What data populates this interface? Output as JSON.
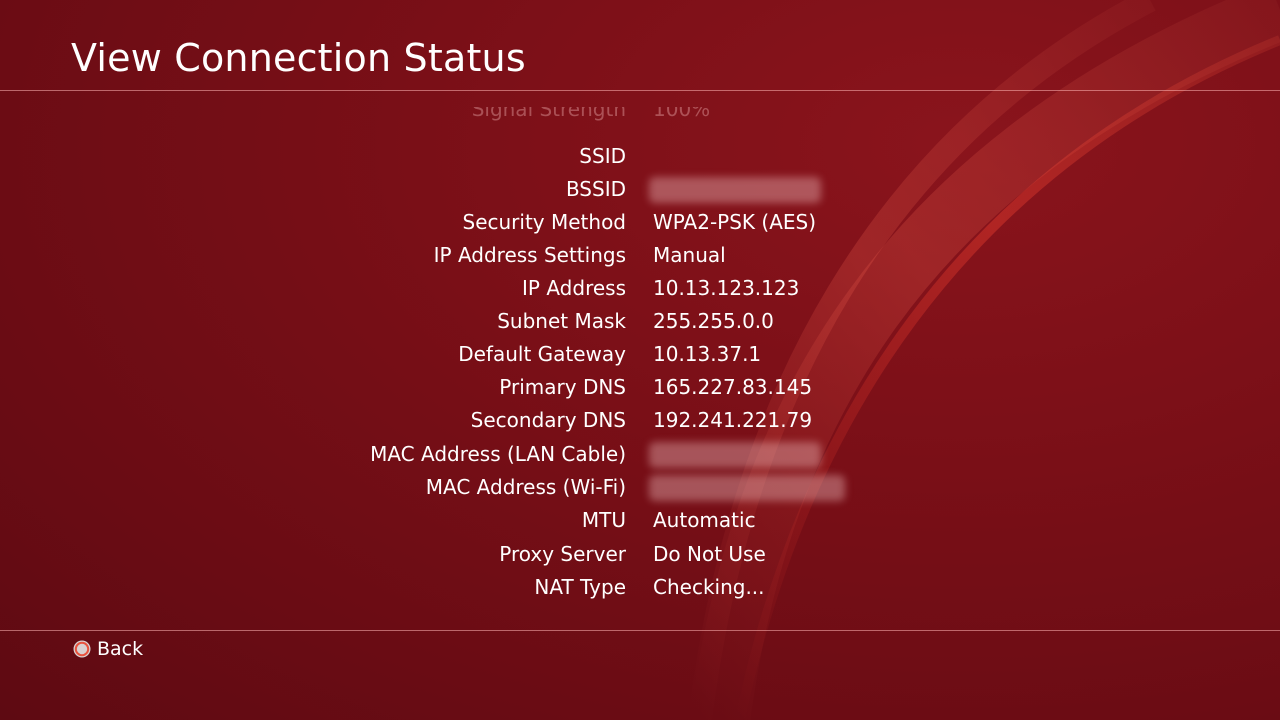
{
  "header": {
    "title": "View Connection Status"
  },
  "rows": [
    {
      "label": "Signal Strength",
      "value": "100%"
    },
    {
      "label": "SSID",
      "value": ""
    },
    {
      "label": "BSSID",
      "value": ""
    },
    {
      "label": "Security Method",
      "value": "WPA2-PSK (AES)"
    },
    {
      "label": "IP Address Settings",
      "value": "Manual"
    },
    {
      "label": "IP Address",
      "value": "10.13.123.123"
    },
    {
      "label": "Subnet Mask",
      "value": "255.255.0.0"
    },
    {
      "label": "Default Gateway",
      "value": "10.13.37.1"
    },
    {
      "label": "Primary DNS",
      "value": "165.227.83.145"
    },
    {
      "label": "Secondary DNS",
      "value": "192.241.221.79"
    },
    {
      "label": "MAC Address (LAN Cable)",
      "value": ""
    },
    {
      "label": "MAC Address (Wi-Fi)",
      "value": ""
    },
    {
      "label": "MTU",
      "value": "Automatic"
    },
    {
      "label": "Proxy Server",
      "value": "Do Not Use"
    },
    {
      "label": "NAT Type",
      "value": "Checking..."
    }
  ],
  "footer": {
    "back_label": "Back",
    "back_icon": "circle-button-icon"
  },
  "colors": {
    "background": "#7a0f17",
    "text": "#ffffff",
    "circle_button": "#e8533f"
  }
}
